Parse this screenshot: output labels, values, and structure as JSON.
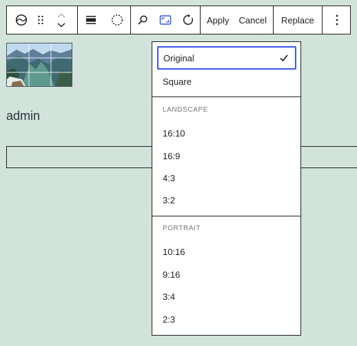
{
  "toolbar": {
    "apply_label": "Apply",
    "cancel_label": "Cancel",
    "replace_label": "Replace"
  },
  "content": {
    "author_name": "admin"
  },
  "aspect_menu": {
    "items_top": [
      {
        "label": "Original",
        "selected": true
      },
      {
        "label": "Square",
        "selected": false
      }
    ],
    "landscape_label": "LANDSCAPE",
    "landscape_items": [
      "16:10",
      "16:9",
      "4:3",
      "3:2"
    ],
    "portrait_label": "PORTRAIT",
    "portrait_items": [
      "10:16",
      "9:16",
      "3:4",
      "2:3"
    ]
  },
  "colors": {
    "background": "#d2e3dc",
    "accent": "#3858e9",
    "text": "#1e1e1e"
  }
}
